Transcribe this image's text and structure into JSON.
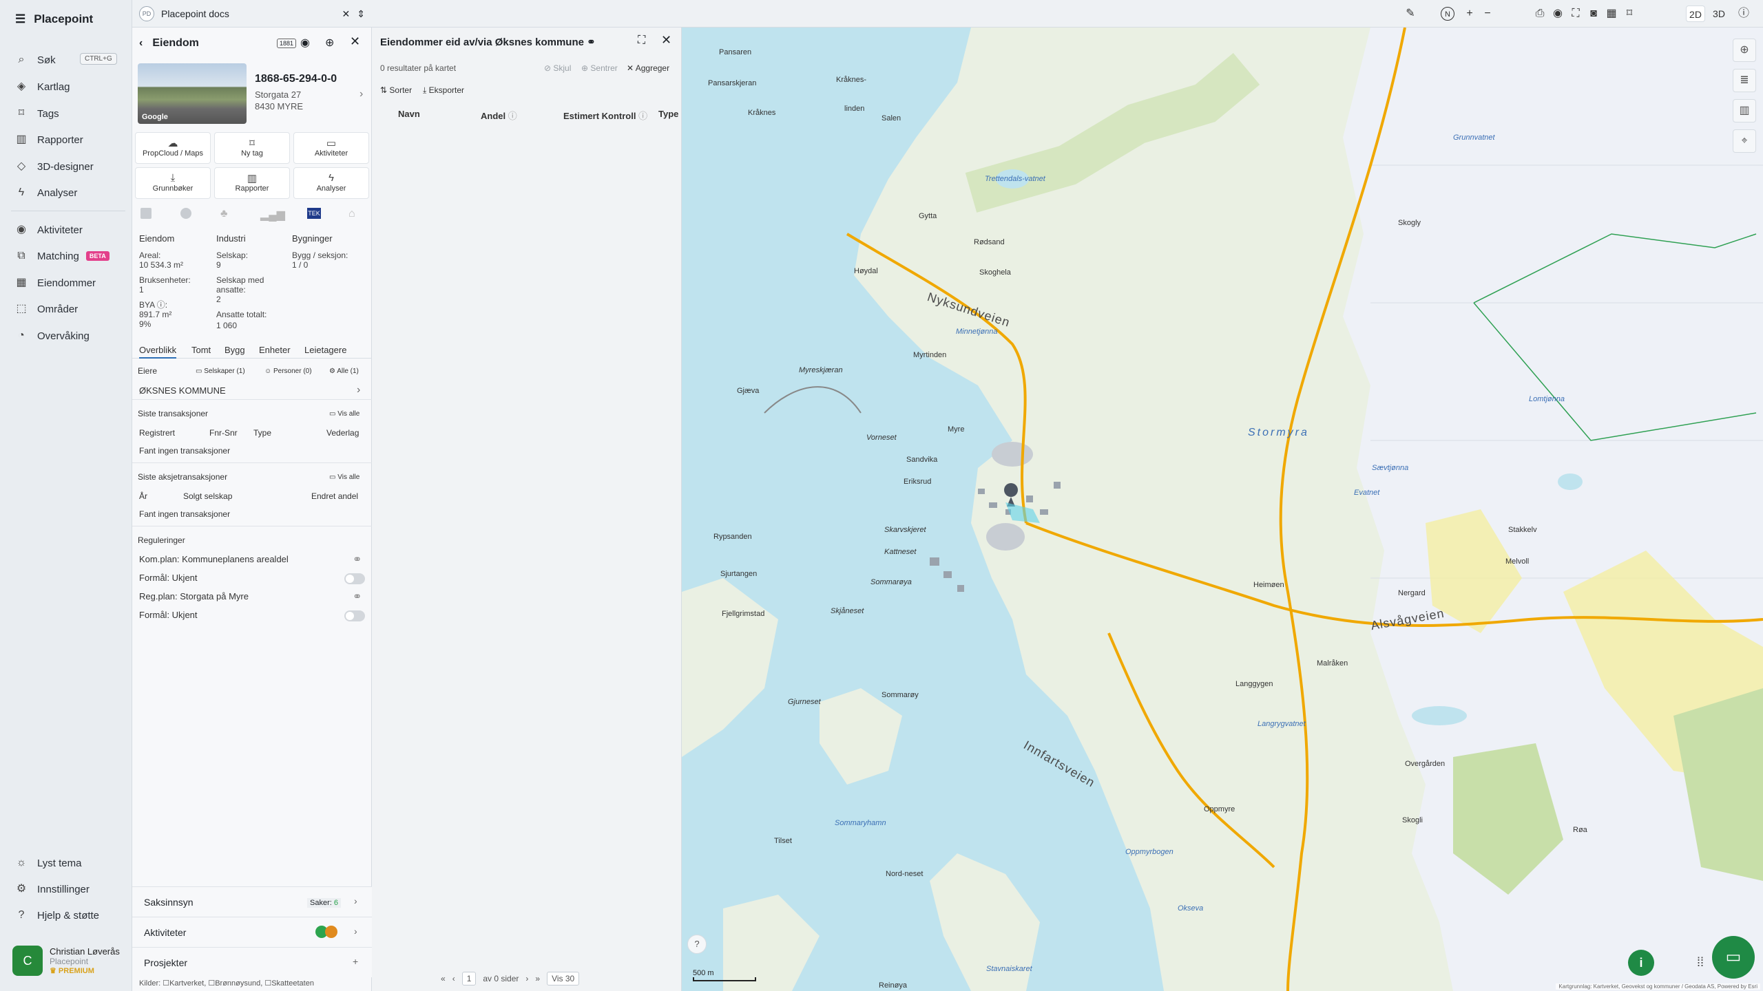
{
  "app": {
    "name": "Placepoint"
  },
  "nav": {
    "items": [
      {
        "label": "Søk",
        "shortcut": "CTRL+G",
        "icon": "search-icon"
      },
      {
        "label": "Kartlag",
        "icon": "layers-icon"
      },
      {
        "label": "Tags",
        "icon": "bookmark-icon"
      },
      {
        "label": "Rapporter",
        "icon": "chart-icon"
      },
      {
        "label": "3D-designer",
        "icon": "cube-icon"
      },
      {
        "label": "Analyser",
        "icon": "bolt-icon"
      },
      {
        "label": "Aktiviteter",
        "icon": "activity-icon"
      },
      {
        "label": "Matching",
        "badge": "BETA",
        "icon": "match-icon"
      },
      {
        "label": "Eiendommer",
        "icon": "building-icon"
      },
      {
        "label": "Områder",
        "icon": "area-icon"
      },
      {
        "label": "Overvåking",
        "icon": "monitor-icon"
      }
    ],
    "bottom": [
      {
        "label": "Lyst tema",
        "icon": "sun-icon"
      },
      {
        "label": "Innstillinger",
        "icon": "gear-icon"
      },
      {
        "label": "Hjelp & støtte",
        "icon": "help-icon"
      }
    ],
    "user": {
      "initial": "C",
      "name": "Christian Løverås",
      "org": "Placepoint",
      "plan": "PREMIUM"
    }
  },
  "docs": {
    "logo": "PD",
    "title": "Placepoint docs"
  },
  "property": {
    "panel_title": "Eiendom",
    "badge": "1881",
    "photo_label": "Google",
    "id": "1868-65-294-0-0",
    "street": "Storgata 27",
    "city": "8430 MYRE",
    "actions": [
      {
        "label": "PropCloud / Maps",
        "icon": "cloud-icon"
      },
      {
        "label": "Ny tag",
        "icon": "bookmark-icon"
      },
      {
        "label": "Aktiviteter",
        "icon": "chat-icon"
      },
      {
        "label": "Grunnbøker",
        "icon": "download-icon"
      },
      {
        "label": "Rapporter",
        "icon": "chart-icon"
      },
      {
        "label": "Analyser",
        "icon": "bolt-icon"
      }
    ],
    "sources": [
      "SSB",
      "Kartverket",
      "Matrikkel",
      "Byggdata",
      "TEK",
      "Bygg"
    ],
    "stats": {
      "col1_title": "Eiendom",
      "areal_label": "Areal:",
      "areal_value": "10 534.3 m²",
      "bruks_label": "Bruksenheter:",
      "bruks_value": "1",
      "bya_label": "BYA ⓘ:",
      "bya_value": "891.7 m²",
      "bya_pct": "9%",
      "col2_title": "Industri",
      "selskap_label": "Selskap:",
      "selskap_value": "9",
      "ansatte_label": "Selskap med ansatte:",
      "ansatte_value": "2",
      "ansatte_tot_label": "Ansatte totalt:",
      "ansatte_tot_value": "1 060",
      "col3_title": "Bygninger",
      "bygg_label": "Bygg / seksjon:",
      "bygg_value": "1 / 0"
    },
    "tabs": [
      "Overblikk",
      "Tomt",
      "Bygg",
      "Enheter",
      "Leietagere"
    ],
    "owners": {
      "title": "Eiere",
      "companies": "Selskaper (1)",
      "persons": "Personer (0)",
      "all": "Alle (1)",
      "owner": "ØKSNES KOMMUNE"
    },
    "transactions": {
      "title": "Siste transaksjoner",
      "view_all": "Vis alle",
      "cols": [
        "Registrert",
        "Fnr-Snr",
        "Type",
        "Vederlag"
      ],
      "empty": "Fant ingen transaksjoner"
    },
    "share_tx": {
      "title": "Siste aksjetransaksjoner",
      "view_all": "Vis alle",
      "cols": [
        "År",
        "Solgt selskap",
        "Endret andel"
      ],
      "empty": "Fant ingen transaksjoner"
    },
    "regulations": {
      "title": "Reguleringer",
      "items": [
        "Kom.plan: Kommuneplanens arealdel",
        "Formål: Ukjent",
        "Reg.plan: Storgata på Myre",
        "Formål: Ukjent"
      ]
    },
    "bottom": {
      "saksinnsyn": "Saksinnsyn",
      "saker_label": "Saker:",
      "saker_value": "6",
      "aktiviteter": "Aktiviteter",
      "prosjekter": "Prosjekter"
    },
    "sources_footer": "Kilder: ☐Kartverket, ☐Brønnøysund, ☐Skatteetaten"
  },
  "owned": {
    "title": "Eiendommer eid av/via Øksnes kommune",
    "count": "0 resultater på kartet",
    "hide": "Skjul",
    "center": "Sentrer",
    "aggregate": "Aggreger",
    "sort": "Sorter",
    "export": "Eksporter",
    "cols": [
      "Navn",
      "Andel",
      "Estimert Kontroll",
      "Type"
    ],
    "pager": {
      "page": "1",
      "of": "av 0 sider",
      "per": "Vis 30"
    }
  },
  "map": {
    "modes": [
      "2D",
      "3D"
    ],
    "scale": "500 m",
    "attribution": "Kartgrunnlag: Kartverket, Geovekst og kommuner / Geodata AS, Powered by Esri",
    "places": [
      "Pansaren",
      "Pansarskjeran",
      "Kråknes",
      "Kråknes-",
      "linden",
      "Salen",
      "Trettendals-vatnet",
      "Gytta",
      "Høydal",
      "Rødsand",
      "Skoghela",
      "Nyksundveien",
      "Minnetjønna",
      "Myrtinden",
      "Myreskjæran",
      "Gjæva",
      "Vorneset",
      "Myre",
      "Sandvika",
      "Eriksrud",
      "Skarvskjeret",
      "Kattneset",
      "Sommarøya",
      "Rypsanden",
      "Sjurtangen",
      "Fjellgrimstad",
      "Skjåneset",
      "Gjurneset",
      "Sommarøy",
      "Innfartsveien",
      "Sommaryhamn",
      "Oppmyre",
      "Oppmyrbogen",
      "Langrygvatnet",
      "Stormyra",
      "Evatnet",
      "Stakkelv",
      "Melvoll",
      "Nergard",
      "Alsvågveien",
      "Heimøen",
      "Skogly",
      "Grunnvatnet",
      "Lomtjønna",
      "Sævtjønna",
      "Overgården",
      "Skogli",
      "Røa",
      "Malråken",
      "Langgygen",
      "Okseva",
      "Reinøya",
      "Nord-neset",
      "Tilset",
      "Stavnaiskaret",
      "Storgata på Myre"
    ],
    "roads": [
      "Nyksundveien",
      "Innfartsveien",
      "Alsvågveien",
      "Stormyra"
    ]
  }
}
